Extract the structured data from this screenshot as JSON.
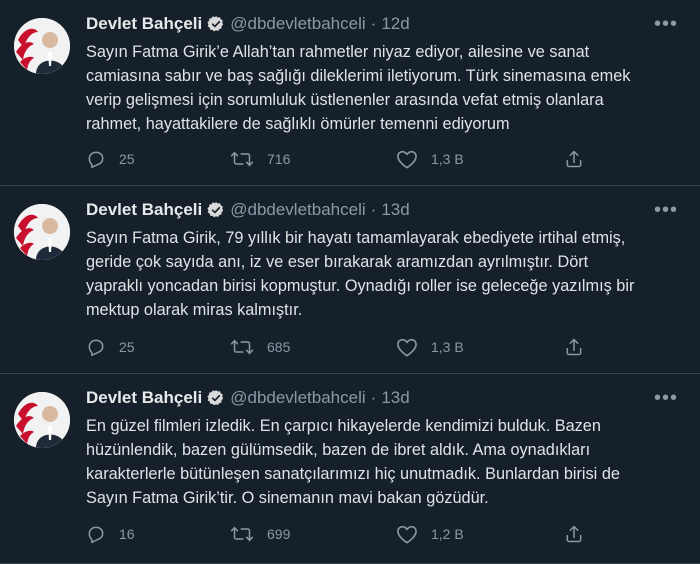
{
  "tweets": [
    {
      "author": {
        "name": "Devlet Bahçeli",
        "handle": "@dbdevletbahceli",
        "verified": true
      },
      "time": "12d",
      "lines": [
        "Sayın Fatma Girik’e Allah’tan rahmetler niyaz ediyor, ailesine ve sanat",
        "camiasına sabır ve baş sağlığı dileklerimi iletiyorum. Türk sinemasına emek",
        "verip gelişmesi için sorumluluk üstlenenler arasında vefat etmiş olanlara",
        "rahmet, hayattakilere de sağlıklı ömürler temenni ediyorum"
      ],
      "stats": {
        "replies": "25",
        "retweets": "716",
        "likes": "1,3 B"
      }
    },
    {
      "author": {
        "name": "Devlet Bahçeli",
        "handle": "@dbdevletbahceli",
        "verified": true
      },
      "time": "13d",
      "lines": [
        "Sayın Fatma Girik, 79 yıllık bir hayatı tamamlayarak ebediyete irtihal etmiş,",
        "geride çok sayıda anı, iz ve eser bırakarak aramızdan ayrılmıştır. Dört",
        "yapraklı yoncadan birisi kopmuştur. Oynadığı roller ise geleceğe yazılmış bir",
        "mektup olarak miras kalmıştır."
      ],
      "stats": {
        "replies": "25",
        "retweets": "685",
        "likes": "1,3 B"
      }
    },
    {
      "author": {
        "name": "Devlet Bahçeli",
        "handle": "@dbdevletbahceli",
        "verified": true
      },
      "time": "13d",
      "lines": [
        "En güzel filmleri izledik. En çarpıcı hikayelerde kendimizi bulduk. Bazen",
        "hüzünlendik, bazen gülümsedik, bazen de ibret aldık. Ama oynadıkları",
        "karakterlerle bütünleşen sanatçılarımızı hiç unutmadık. Bunlardan birisi de",
        "Sayın Fatma Girik’tir. O sinemanın mavi bakan gözüdür."
      ],
      "stats": {
        "replies": "16",
        "retweets": "699",
        "likes": "1,2 B"
      }
    }
  ],
  "icons": {
    "reply": "reply-icon",
    "retweet": "retweet-icon",
    "like": "heart-icon",
    "share": "share-icon",
    "more": "more-icon",
    "verified": "verified-badge-icon"
  },
  "colors": {
    "background": "#15202b",
    "divider": "#38444d",
    "text": "#dfe3e6",
    "muted": "#8b98a5",
    "verified_badge": "#d9d9d9"
  }
}
